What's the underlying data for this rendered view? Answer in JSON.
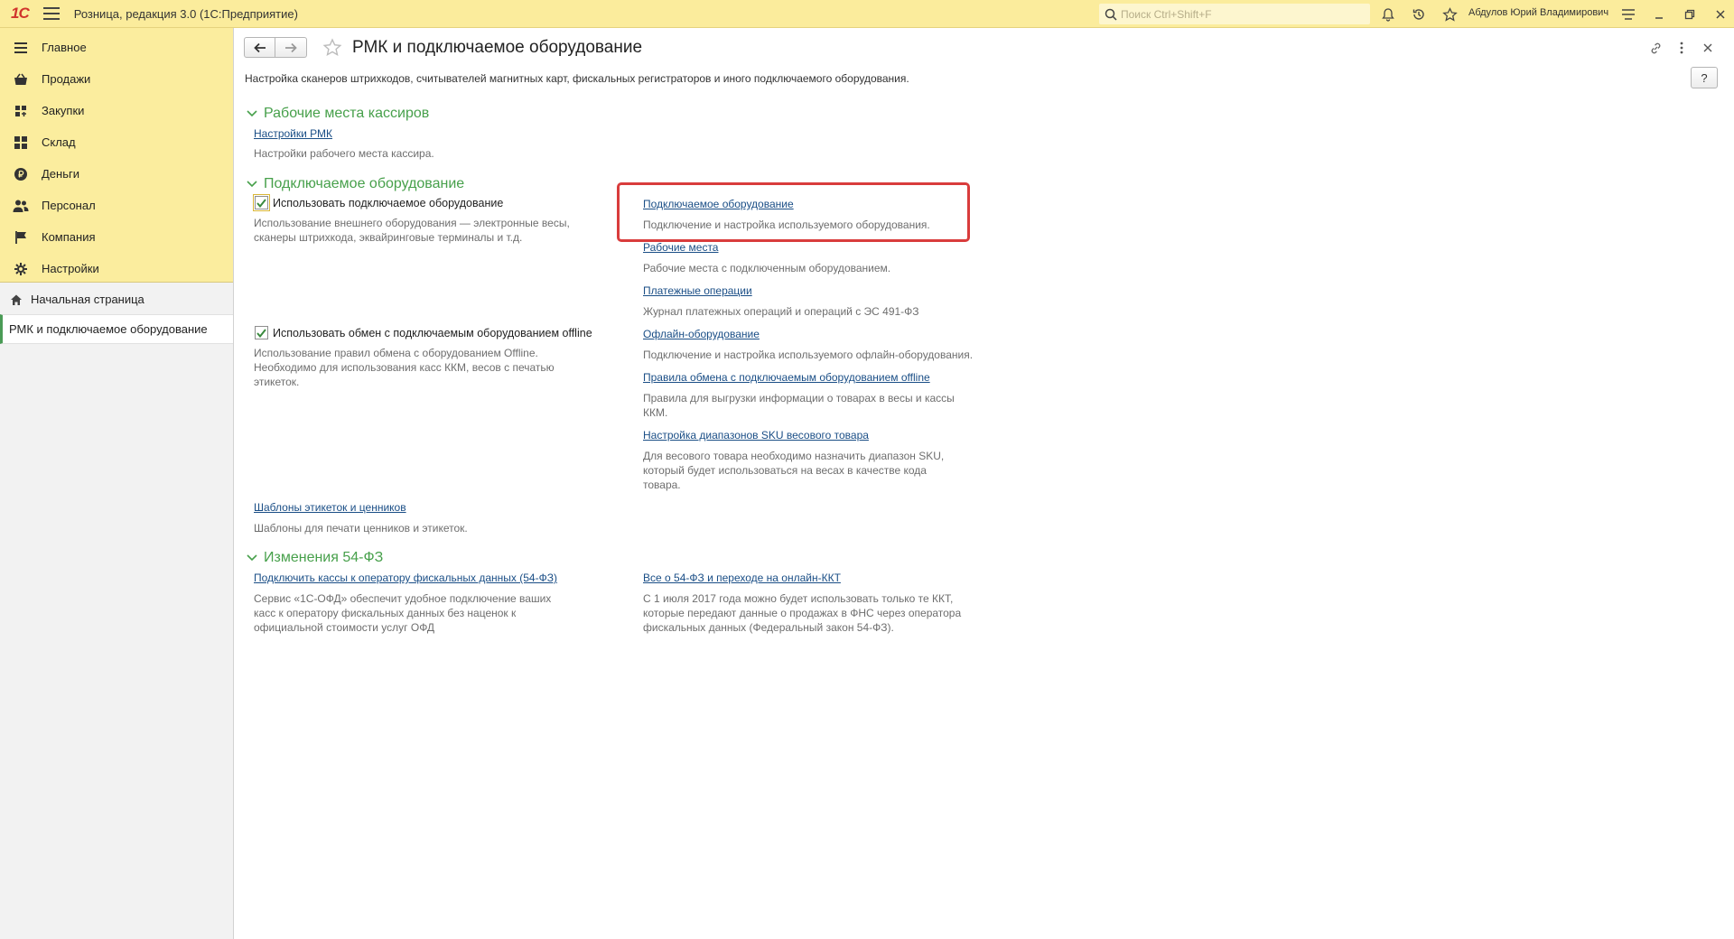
{
  "titlebar": {
    "logo": "1С",
    "app_title": "Розница, редакция 3.0  (1С:Предприятие)",
    "search_placeholder": "Поиск Ctrl+Shift+F",
    "user_name": "Абдулов Юрий Владимирович",
    "icons": [
      "bell-icon",
      "history-icon",
      "favorites-star-icon",
      "menu-icon",
      "minimize-icon",
      "restore-icon",
      "close-icon"
    ]
  },
  "sidebar": {
    "sections": [
      {
        "label": "Главное",
        "icon": "list-icon"
      },
      {
        "label": "Продажи",
        "icon": "cart-icon"
      },
      {
        "label": "Закупки",
        "icon": "purchase-icon"
      },
      {
        "label": "Склад",
        "icon": "warehouse-icon"
      },
      {
        "label": "Деньги",
        "icon": "money-icon"
      },
      {
        "label": "Персонал",
        "icon": "people-icon"
      },
      {
        "label": "Компания",
        "icon": "flag-icon"
      },
      {
        "label": "Настройки",
        "icon": "gear-icon"
      }
    ],
    "open_windows": [
      {
        "label": "Начальная страница",
        "icon": "home-icon"
      },
      {
        "label": "РМК и подключаемое оборудование",
        "active": true
      }
    ]
  },
  "main": {
    "title": "РМК и подключаемое оборудование",
    "description": "Настройка сканеров штрихкодов, считывателей магнитных карт, фискальных регистраторов и иного подключаемого оборудования.",
    "help_label": "?",
    "groups": {
      "cashier": {
        "title": "Рабочие места кассиров",
        "link": "Настройки РМК",
        "note": "Настройки рабочего места кассира."
      },
      "equipment": {
        "title": "Подключаемое оборудование",
        "use_equipment": {
          "label": "Использовать подключаемое оборудование",
          "checked": true,
          "note_line1": "Использование внешнего оборудования — электронные весы,",
          "note_line2": "сканеры штрихкода, эквайринговые терминалы и т.д."
        },
        "use_offline": {
          "label": "Использовать обмен с подключаемым оборудованием offline",
          "checked": true,
          "note_line1": "Использование правил обмена с оборудованием Offline.",
          "note_line2": "Необходимо для использования касс ККМ, весов с печатью",
          "note_line3": "этикеток."
        },
        "links": [
          {
            "label": "Подключаемое оборудование",
            "note": "Подключение и настройка используемого оборудования."
          },
          {
            "label": "Рабочие места",
            "note": "Рабочие места с подключенным оборудованием."
          },
          {
            "label": "Платежные операции",
            "note": "Журнал платежных операций и операций с ЭС 491-ФЗ"
          },
          {
            "label": "Офлайн-оборудование",
            "note": "Подключение и настройка используемого офлайн-оборудования."
          },
          {
            "label": "Правила обмена с подключаемым оборудованием offline",
            "note_line1": "Правила для выгрузки информации о товарах в весы и кассы",
            "note_line2": "ККМ."
          },
          {
            "label": "Настройка диапазонов SKU весового товара",
            "note_line1": "Для весового товара необходимо назначить диапазон SKU,",
            "note_line2": "который будет использоваться на весах в качестве кода",
            "note_line3": "товара."
          }
        ],
        "templates_link": "Шаблоны этикеток и ценников",
        "templates_note": "Шаблоны для печати ценников и этикеток."
      },
      "fz54": {
        "title": "Изменения 54-ФЗ",
        "left_link": "Подключить кассы к оператору фискальных данных (54-ФЗ)",
        "left_note_line1": "Сервис  «1С-ОФД» обеспечит удобное подключение ваших",
        "left_note_line2": "касс к оператору фискальных данных без наценок к",
        "left_note_line3": "официальной стоимости услуг ОФД",
        "right_link": "Все о 54-ФЗ и переходе на онлайн-ККТ",
        "right_note_line1": "С 1 июля 2017 года можно будет использовать только те ККТ,",
        "right_note_line2": "которые передают данные о продажах в ФНС через оператора",
        "right_note_line3": "фискальных данных (Федеральный закон 54-ФЗ)."
      }
    }
  },
  "colors": {
    "titlebar_bg": "#fbec9c",
    "group_title": "#47a04b",
    "link": "#1a4e86",
    "highlight_box": "#d93c3c",
    "active_marker": "#4a9b56"
  }
}
